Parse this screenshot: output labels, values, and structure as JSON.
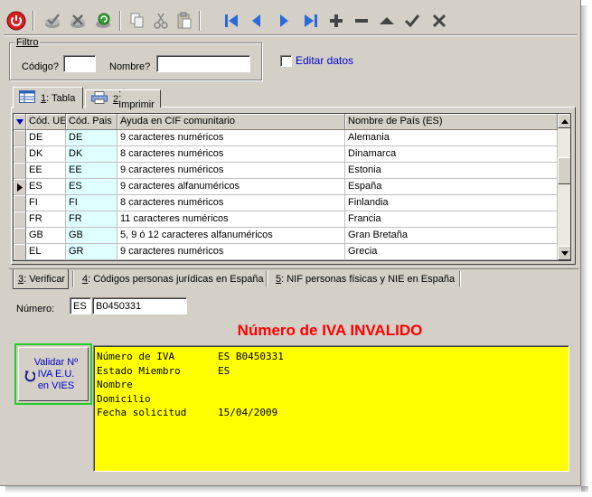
{
  "filter": {
    "legend": "Filtro",
    "codigo_label": "Código?",
    "codigo_value": "",
    "nombre_label": "Nombre?",
    "nombre_value": ""
  },
  "edit_toggle": {
    "label": "Editar datos",
    "checked": false
  },
  "tabs": [
    {
      "key": "1",
      "label": ": Tabla",
      "active": true
    },
    {
      "key": "2",
      "label": ": Imprimir",
      "active": false
    }
  ],
  "table": {
    "columns": [
      "Cód. UE",
      "Cód. Pais",
      "Ayuda en CIF comunitario",
      "Nombre de País (ES)"
    ],
    "rows": [
      {
        "ue": "DE",
        "pais": "DE",
        "ayuda": "9 caracteres numéricos",
        "nombre": "Alemania",
        "current": false
      },
      {
        "ue": "DK",
        "pais": "DK",
        "ayuda": "8 caracteres numéricos",
        "nombre": "Dinamarca",
        "current": false
      },
      {
        "ue": "EE",
        "pais": "EE",
        "ayuda": "9 caracteres numéricos",
        "nombre": "Estonia",
        "current": false
      },
      {
        "ue": "ES",
        "pais": "ES",
        "ayuda": "9 caracteres alfanuméricos",
        "nombre": "España",
        "current": true
      },
      {
        "ue": "FI",
        "pais": "FI",
        "ayuda": "8 caracteres numéricos",
        "nombre": "Finlandia",
        "current": false
      },
      {
        "ue": "FR",
        "pais": "FR",
        "ayuda": "11 caracteres numéricos",
        "nombre": "Francia",
        "current": false
      },
      {
        "ue": "GB",
        "pais": "GB",
        "ayuda": "5, 9 ó 12 caracteres alfanuméricos",
        "nombre": "Gran Bretaña",
        "current": false
      },
      {
        "ue": "EL",
        "pais": "GR",
        "ayuda": "9 caracteres numéricos",
        "nombre": "Grecia",
        "current": false
      }
    ]
  },
  "lower_tabs": [
    {
      "key": "3",
      "label": ": Verificar",
      "active": true
    },
    {
      "key": "4",
      "label": ": Códigos personas jurídicas en España",
      "active": false
    },
    {
      "key": "5",
      "label": ": NIF personas físicas y NIE en España",
      "active": false
    }
  ],
  "numero": {
    "label": "Número:",
    "prefix": "ES",
    "value": "B0450331"
  },
  "status_title": "Número de IVA INVALIDO",
  "validate_button": {
    "line1": "Validar Nº",
    "line2": "IVA E.U.",
    "line3": "en VIES"
  },
  "result": [
    {
      "key": "Número de IVA",
      "value": "ES B0450331"
    },
    {
      "key": "Estado Miembro",
      "value": "ES"
    },
    {
      "key": "Nombre",
      "value": ""
    },
    {
      "key": "Domicilio",
      "value": ""
    },
    {
      "key": "Fecha solicitud",
      "value": "15/04/2009"
    }
  ],
  "colors": {
    "status_invalid": "#ff0000",
    "result_bg": "#ffff00",
    "accent": "#0000cc"
  }
}
